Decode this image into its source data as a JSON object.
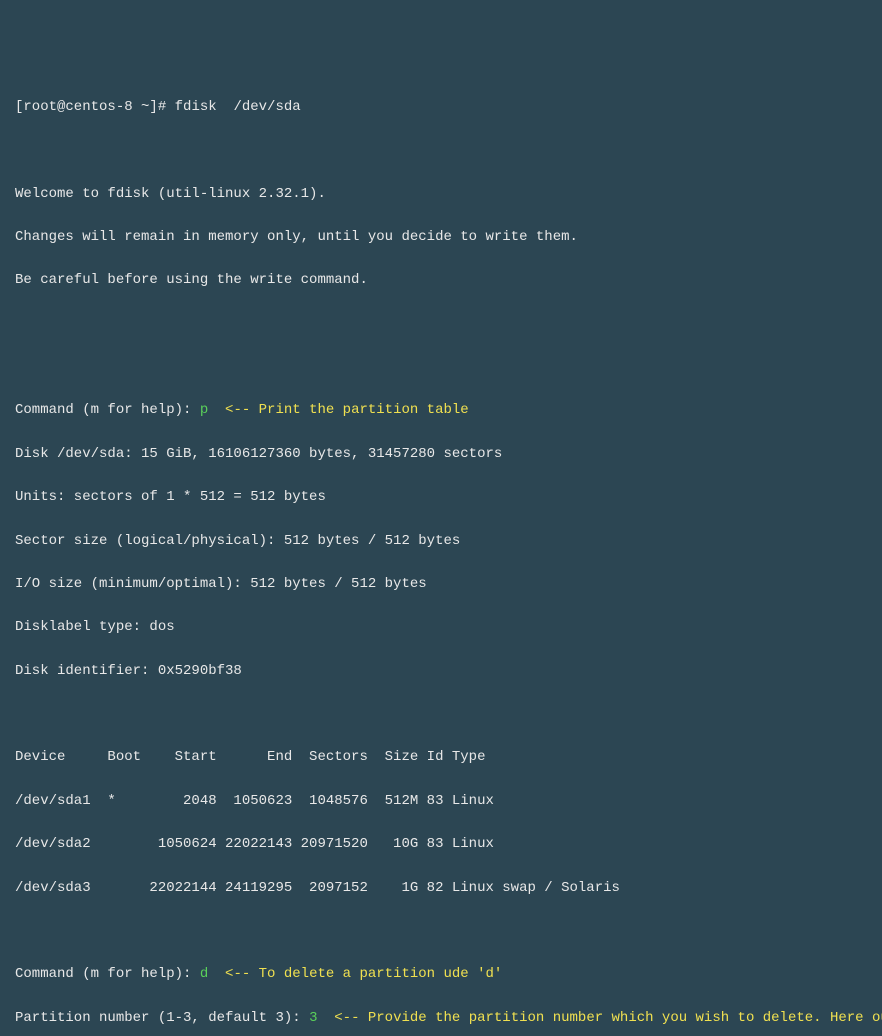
{
  "prompt": "[root@centos-8 ~]# ",
  "command": "fdisk  /dev/sda",
  "welcome1": "Welcome to fdisk (util-linux 2.32.1).",
  "welcome2": "Changes will remain in memory only, until you decide to write them.",
  "welcome3": "Be careful before using the write command.",
  "cmdPrompt1": "Command (m for help): ",
  "cmdP": "p",
  "annotP": "  <-- Print the partition table",
  "diskInfo1": "Disk /dev/sda: 15 GiB, 16106127360 bytes, 31457280 sectors",
  "diskInfo2": "Units: sectors of 1 * 512 = 512 bytes",
  "diskInfo3": "Sector size (logical/physical): 512 bytes / 512 bytes",
  "diskInfo4": "I/O size (minimum/optimal): 512 bytes / 512 bytes",
  "diskInfo5": "Disklabel type: dos",
  "diskInfo6": "Disk identifier: 0x5290bf38",
  "tableHeader": "Device     Boot    Start      End  Sectors  Size Id Type",
  "row1": "/dev/sda1  *        2048  1050623  1048576  512M 83 Linux",
  "row2": "/dev/sda2        1050624 22022143 20971520   10G 83 Linux",
  "row3": "/dev/sda3       22022144 24119295  2097152    1G 82 Linux swap / Solaris",
  "cmdPrompt2": "Command (m for help): ",
  "cmdD": "d",
  "annotD": "  <-- To delete a partition ude 'd'",
  "partNumPrompt": "Partition number (1-3, default 3): ",
  "cmd3": "3",
  "annot3": "  <-- Provide the partition number which you wish to delete. Here our "
}
